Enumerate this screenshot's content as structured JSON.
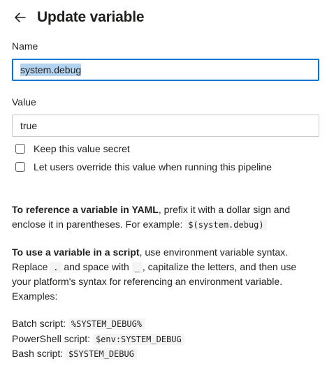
{
  "header": {
    "title": "Update variable",
    "back_icon": "arrow-left-icon"
  },
  "name_field": {
    "label": "Name",
    "value": "system.debug"
  },
  "value_field": {
    "label": "Value",
    "value": "true"
  },
  "options": {
    "keep_secret": {
      "label": "Keep this value secret",
      "checked": false
    },
    "allow_override": {
      "label": "Let users override this value when running this pipeline",
      "checked": false
    }
  },
  "help": {
    "yaml_bold": "To reference a variable in YAML",
    "yaml_text": ", prefix it with a dollar sign and enclose it in parentheses. For example: ",
    "yaml_example": "$(system.debug)",
    "script_bold": "To use a variable in a script",
    "script_text1": ", use environment variable syntax. Replace ",
    "script_dot": ".",
    "script_text2": " and space with ",
    "script_underscore": "_",
    "script_text3": ", capitalize the letters, and then use your platform's syntax for referencing an environment variable. Examples:",
    "examples": [
      {
        "label": "Batch script: ",
        "code": "%SYSTEM_DEBUG%"
      },
      {
        "label": "PowerShell script: ",
        "code": "$env:SYSTEM_DEBUG"
      },
      {
        "label": "Bash script: ",
        "code": "$SYSTEM_DEBUG"
      }
    ]
  },
  "colors": {
    "focus_border": "#0078d4",
    "selection": "#b3d3f0",
    "text": "#201f1e",
    "code_bg": "#f4f4f4"
  }
}
